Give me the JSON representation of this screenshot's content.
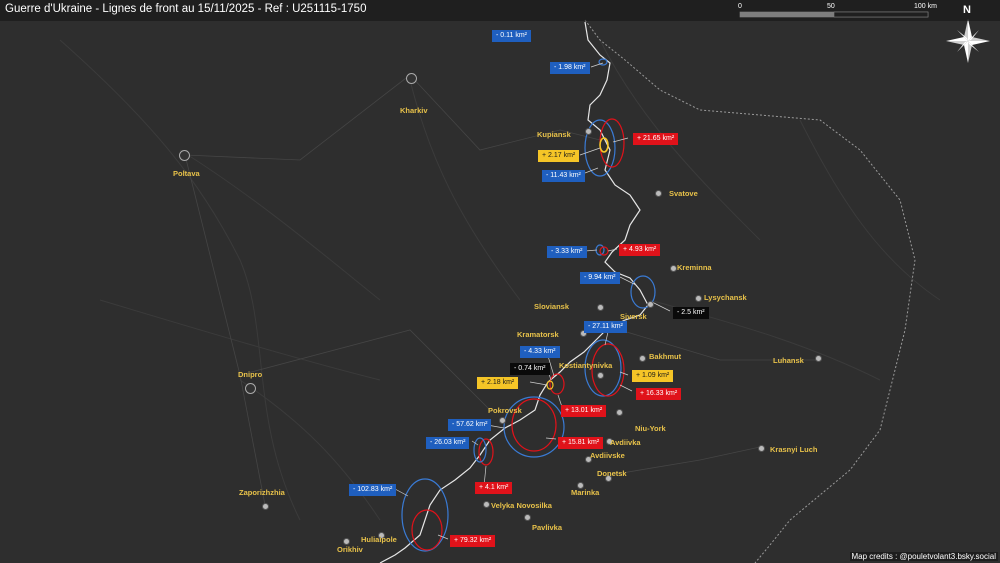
{
  "title": "Guerre d'Ukraine - Lignes de front au 15/11/2025 - Ref : U251115-1750",
  "credits": "Map credits : @pouletvolant3.bsky.social",
  "compass": "N",
  "scale": {
    "labels": [
      "0",
      "50",
      "100 km"
    ]
  },
  "colors": {
    "background": "#2e2e2e",
    "front_line": "#dddddd",
    "gain_blue": "#1f5fbf",
    "gain_red": "#e0121a",
    "gain_yellow": "#f5c527",
    "black": "#0a0a0a",
    "city_label": "#e8c24a"
  },
  "cities": [
    {
      "name": "Kharkiv",
      "lng": 36.23,
      "lat": 49.99
    },
    {
      "name": "Poltava",
      "lng": 34.55,
      "lat": 49.59
    },
    {
      "name": "Kupiansk",
      "lng": 37.61,
      "lat": 49.71
    },
    {
      "name": "Svatove",
      "lng": 38.16,
      "lat": 49.41
    },
    {
      "name": "Kreminna",
      "lng": 38.22,
      "lat": 49.05
    },
    {
      "name": "Lysychansk",
      "lng": 38.43,
      "lat": 48.92
    },
    {
      "name": "Siversk",
      "lng": 38.1,
      "lat": 48.87
    },
    {
      "name": "Sloviansk",
      "lng": 37.61,
      "lat": 48.85
    },
    {
      "name": "Kramatorsk",
      "lng": 37.56,
      "lat": 48.72
    },
    {
      "name": "Bakhmut",
      "lng": 38.0,
      "lat": 48.59
    },
    {
      "name": "Kostiantynivka",
      "lng": 37.71,
      "lat": 48.53
    },
    {
      "name": "Luhansk",
      "lng": 39.31,
      "lat": 48.57
    },
    {
      "name": "Dnipro",
      "lng": 35.05,
      "lat": 48.46
    },
    {
      "name": "Pokrovsk",
      "lng": 37.18,
      "lat": 48.28
    },
    {
      "name": "Niu-York",
      "lng": 37.83,
      "lat": 48.33
    },
    {
      "name": "Avdiivka",
      "lng": 37.75,
      "lat": 48.14
    },
    {
      "name": "Avdiivske",
      "lng": 37.63,
      "lat": 48.11
    },
    {
      "name": "Donetsk",
      "lng": 37.8,
      "lat": 48.0
    },
    {
      "name": "Marinka",
      "lng": 37.5,
      "lat": 47.94
    },
    {
      "name": "Krasnyi Luch",
      "lng": 38.93,
      "lat": 48.13
    },
    {
      "name": "Zaporizhzhia",
      "lng": 35.14,
      "lat": 47.84
    },
    {
      "name": "Velyka Novosilka",
      "lng": 36.83,
      "lat": 47.84
    },
    {
      "name": "Pavlivka",
      "lng": 37.04,
      "lat": 47.71
    },
    {
      "name": "Huliaipole",
      "lng": 36.26,
      "lat": 47.66
    },
    {
      "name": "Orikhiv",
      "lng": 35.79,
      "lat": 47.57
    }
  ],
  "changes": [
    {
      "label": "- 0.11 km²",
      "color": "blue"
    },
    {
      "label": "- 1.98 km²",
      "color": "blue"
    },
    {
      "label": "+ 21.65 km²",
      "color": "red"
    },
    {
      "label": "+ 2.17 km²",
      "color": "yellow"
    },
    {
      "label": "- 11.43 km²",
      "color": "blue"
    },
    {
      "label": "- 3.33 km²",
      "color": "blue"
    },
    {
      "label": "+ 4.93 km²",
      "color": "red"
    },
    {
      "label": "- 9.94 km²",
      "color": "blue"
    },
    {
      "label": "- 2.5 km²",
      "color": "black"
    },
    {
      "label": "- 27.11 km²",
      "color": "blue"
    },
    {
      "label": "- 4.33 km²",
      "color": "blue"
    },
    {
      "label": "- 0.74 km²",
      "color": "black"
    },
    {
      "label": "+ 2.18 km²",
      "color": "yellow"
    },
    {
      "label": "+ 1.09 km²",
      "color": "yellow"
    },
    {
      "label": "+ 16.33 km²",
      "color": "red"
    },
    {
      "label": "+ 13.01 km²",
      "color": "red"
    },
    {
      "label": "- 57.62 km²",
      "color": "blue"
    },
    {
      "label": "- 26.03 km²",
      "color": "blue"
    },
    {
      "label": "+ 15.81 km²",
      "color": "red"
    },
    {
      "label": "+ 4.1 km²",
      "color": "red"
    },
    {
      "label": "- 102.83 km²",
      "color": "blue"
    },
    {
      "label": "+ 79.32 km²",
      "color": "red"
    }
  ]
}
